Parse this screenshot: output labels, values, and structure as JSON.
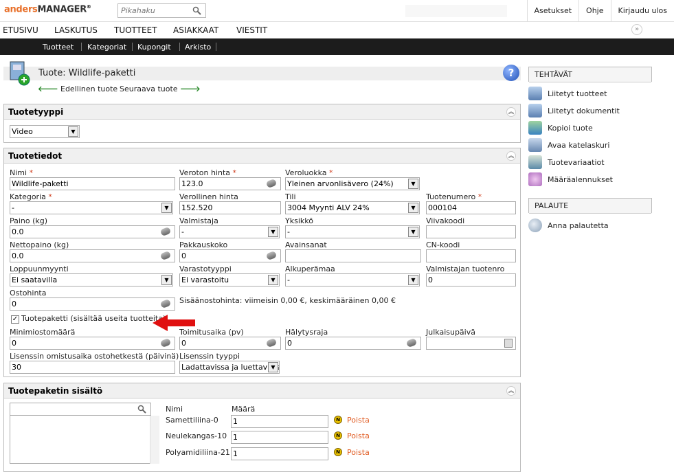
{
  "app": {
    "logo_brand": "anders",
    "logo_product": "MANAGER",
    "logo_reg": "®"
  },
  "search": {
    "placeholder": "Pikahaku"
  },
  "topmenu": {
    "settings": "Asetukset",
    "help": "Ohje",
    "logout": "Kirjaudu ulos"
  },
  "nav": {
    "items": [
      "ETUSIVU",
      "LASKUTUS",
      "TUOTTEET",
      "ASIAKKAAT",
      "VIESTIT"
    ],
    "expand": "»"
  },
  "subnav": {
    "items": [
      "Tuotteet",
      "Kategoriat",
      "Kupongit",
      "Arkisto"
    ]
  },
  "page": {
    "title": "Tuote: Wildlife-paketti",
    "prev": "Edellinen tuote",
    "next": "Seuraava tuote",
    "help": "?"
  },
  "tuotetyyppi": {
    "heading": "Tuotetyyppi",
    "value": "Video"
  },
  "tuotetiedot": {
    "heading": "Tuotetiedot",
    "nimi": {
      "label": "Nimi",
      "value": "Wildlife-paketti"
    },
    "veroton": {
      "label": "Veroton hinta",
      "value": "123.0"
    },
    "veroluokka": {
      "label": "Veroluokka",
      "value": "Yleinen arvonlisävero (24%)"
    },
    "kategoria": {
      "label": "Kategoria",
      "value": "-"
    },
    "verollinen": {
      "label": "Verollinen hinta",
      "value": "152.520"
    },
    "tili": {
      "label": "Tili",
      "value": "3004 Myynti ALV 24%"
    },
    "tuotenumero": {
      "label": "Tuotenumero",
      "value": "000104"
    },
    "paino": {
      "label": "Paino (kg)",
      "value": "0.0"
    },
    "valmistaja": {
      "label": "Valmistaja",
      "value": "-"
    },
    "yksikko": {
      "label": "Yksikkö",
      "value": "-"
    },
    "viivakoodi": {
      "label": "Viivakoodi",
      "value": ""
    },
    "nettopaino": {
      "label": "Nettopaino (kg)",
      "value": "0.0"
    },
    "pakkauskoko": {
      "label": "Pakkauskoko",
      "value": "0"
    },
    "avainsanat": {
      "label": "Avainsanat",
      "value": ""
    },
    "cnkoodi": {
      "label": "CN-koodi",
      "value": ""
    },
    "loppuunmyynti": {
      "label": "Loppuunmyynti",
      "value": "Ei saatavilla"
    },
    "varastotyyppi": {
      "label": "Varastotyyppi",
      "value": "Ei varastoitu"
    },
    "alkuperamaa": {
      "label": "Alkuperämaa",
      "value": "-"
    },
    "valmistajan_tuotenro": {
      "label": "Valmistajan tuotenro",
      "value": "0"
    },
    "ostohinta": {
      "label": "Ostohinta",
      "value": "0"
    },
    "ostohinta_info": "Sisäänostohinta: viimeisin 0,00 €, keskimääräinen 0,00 €",
    "tuotepaketti": {
      "label": "Tuotepaketti (sisältää useita tuotteita)",
      "checked": "✓"
    },
    "minimitilaus": {
      "label": "Minimiostomäärä",
      "value": "0"
    },
    "toimitusaika": {
      "label": "Toimitusaika (pv)",
      "value": "0"
    },
    "halytysraja": {
      "label": "Hälytysraja",
      "value": "0"
    },
    "julkaisupaiva": {
      "label": "Julkaisupäivä",
      "value": ""
    },
    "lisenssi_aika": {
      "label": "Lisenssin omistusaika ostohetkestä (päivinä)",
      "value": "30"
    },
    "lisenssi_tyyppi": {
      "label": "Lisenssin tyyppi",
      "value": "Ladattavissa ja luettavissa"
    }
  },
  "paketti": {
    "heading": "Tuotepaketin sisältö",
    "col_name": "Nimi",
    "col_qty": "Määrä",
    "rows": [
      {
        "name": "Samettiliina-0",
        "qty": "1",
        "remove": "Poista",
        "badge": "N"
      },
      {
        "name": "Neulekangas-10",
        "qty": "1",
        "remove": "Poista",
        "badge": "N"
      },
      {
        "name": "Polyamidiliina-21",
        "qty": "1",
        "remove": "Poista",
        "badge": "N"
      }
    ]
  },
  "sidebar": {
    "tasks_heading": "TEHTÄVÄT",
    "tasks": [
      "Liitetyt tuotteet",
      "Liitetyt dokumentit",
      "Kopioi tuote",
      "Avaa katelaskuri",
      "Tuotevariaatiot",
      "Määräalennukset"
    ],
    "feedback_heading": "PALAUTE",
    "feedback": "Anna palautetta"
  },
  "icons": [
    "search-icon",
    "help-icon",
    "collapse-icon",
    "spinner-icon",
    "calendar-icon",
    "dropdown-arrow-icon",
    "back-arrow-icon",
    "forward-arrow-icon"
  ]
}
